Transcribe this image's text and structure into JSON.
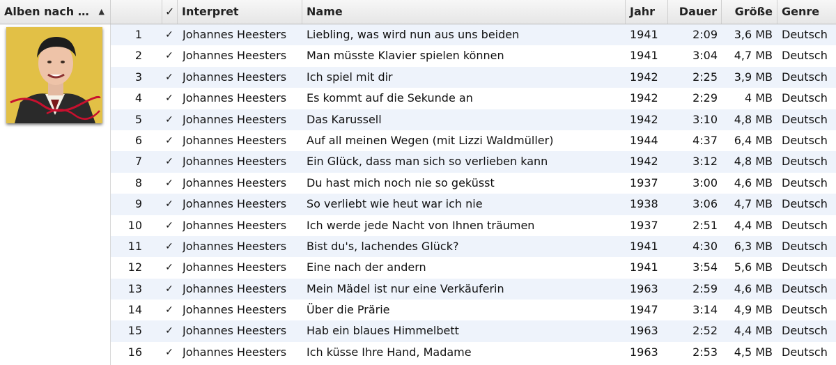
{
  "header": {
    "album_sort": "Alben nach …",
    "check": "✓",
    "artist": "Interpret",
    "name": "Name",
    "year": "Jahr",
    "duration": "Dauer",
    "size": "Größe",
    "genre": "Genre"
  },
  "album": {
    "cover_colors": {
      "background": "#e8c64a",
      "accent": "#c8102e",
      "suit": "#2a2a2a"
    }
  },
  "tracks": [
    {
      "num": "1",
      "check": "✓",
      "artist": "Johannes Heesters",
      "name": "Liebling, was wird nun aus uns beiden",
      "year": "1941",
      "duration": "2:09",
      "size": "3,6 MB",
      "genre": "Deutsch"
    },
    {
      "num": "2",
      "check": "✓",
      "artist": "Johannes Heesters",
      "name": "Man müsste Klavier spielen können",
      "year": "1941",
      "duration": "3:04",
      "size": "4,7 MB",
      "genre": "Deutsch"
    },
    {
      "num": "3",
      "check": "✓",
      "artist": "Johannes Heesters",
      "name": "Ich spiel mit dir",
      "year": "1942",
      "duration": "2:25",
      "size": "3,9 MB",
      "genre": "Deutsch"
    },
    {
      "num": "4",
      "check": "✓",
      "artist": "Johannes Heesters",
      "name": "Es kommt auf die Sekunde an",
      "year": "1942",
      "duration": "2:29",
      "size": "4 MB",
      "genre": "Deutsch"
    },
    {
      "num": "5",
      "check": "✓",
      "artist": "Johannes Heesters",
      "name": "Das Karussell",
      "year": "1942",
      "duration": "3:10",
      "size": "4,8 MB",
      "genre": "Deutsch"
    },
    {
      "num": "6",
      "check": "✓",
      "artist": "Johannes Heesters",
      "name": "Auf all meinen Wegen (mit Lizzi Waldmüller)",
      "year": "1944",
      "duration": "4:37",
      "size": "6,4 MB",
      "genre": "Deutsch"
    },
    {
      "num": "7",
      "check": "✓",
      "artist": "Johannes Heesters",
      "name": "Ein Glück, dass man sich so verlieben kann",
      "year": "1942",
      "duration": "3:12",
      "size": "4,8 MB",
      "genre": "Deutsch"
    },
    {
      "num": "8",
      "check": "✓",
      "artist": "Johannes Heesters",
      "name": "Du hast mich noch nie so geküsst",
      "year": "1937",
      "duration": "3:00",
      "size": "4,6 MB",
      "genre": "Deutsch"
    },
    {
      "num": "9",
      "check": "✓",
      "artist": "Johannes Heesters",
      "name": "So verliebt wie heut war ich nie",
      "year": "1938",
      "duration": "3:06",
      "size": "4,7 MB",
      "genre": "Deutsch"
    },
    {
      "num": "10",
      "check": "✓",
      "artist": "Johannes Heesters",
      "name": "Ich werde jede Nacht von Ihnen träumen",
      "year": "1937",
      "duration": "2:51",
      "size": "4,4 MB",
      "genre": "Deutsch"
    },
    {
      "num": "11",
      "check": "✓",
      "artist": "Johannes Heesters",
      "name": "Bist du's, lachendes Glück?",
      "year": "1941",
      "duration": "4:30",
      "size": "6,3 MB",
      "genre": "Deutsch"
    },
    {
      "num": "12",
      "check": "✓",
      "artist": "Johannes Heesters",
      "name": "Eine nach der andern",
      "year": "1941",
      "duration": "3:54",
      "size": "5,6 MB",
      "genre": "Deutsch"
    },
    {
      "num": "13",
      "check": "✓",
      "artist": "Johannes Heesters",
      "name": "Mein Mädel ist nur eine Verkäuferin",
      "year": "1963",
      "duration": "2:59",
      "size": "4,6 MB",
      "genre": "Deutsch"
    },
    {
      "num": "14",
      "check": "✓",
      "artist": "Johannes Heesters",
      "name": "Über die Prärie",
      "year": "1947",
      "duration": "3:14",
      "size": "4,9 MB",
      "genre": "Deutsch"
    },
    {
      "num": "15",
      "check": "✓",
      "artist": "Johannes Heesters",
      "name": "Hab ein blaues Himmelbett",
      "year": "1963",
      "duration": "2:52",
      "size": "4,4 MB",
      "genre": "Deutsch"
    },
    {
      "num": "16",
      "check": "✓",
      "artist": "Johannes Heesters",
      "name": "Ich küsse Ihre Hand, Madame",
      "year": "1963",
      "duration": "2:53",
      "size": "4,5 MB",
      "genre": "Deutsch"
    }
  ]
}
